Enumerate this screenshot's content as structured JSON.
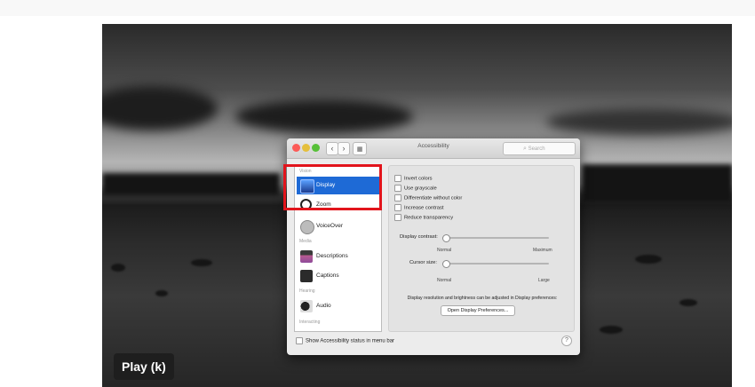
{
  "video": {
    "play_tooltip": "Play (k)"
  },
  "window": {
    "title": "Accessibility",
    "search_placeholder": "Search",
    "nav_back": "‹",
    "nav_forward": "›",
    "grid_icon": "grid-icon",
    "sidebar": {
      "sections": [
        "Vision",
        "Media",
        "Hearing",
        "Interacting"
      ],
      "items": [
        {
          "label": "Display",
          "icon": "display-icon",
          "selected": true
        },
        {
          "label": "Zoom",
          "icon": "zoom-icon",
          "selected": false
        },
        {
          "label": "VoiceOver",
          "icon": "voiceover-icon",
          "selected": false
        },
        {
          "label": "Descriptions",
          "icon": "descriptions-icon",
          "selected": false
        },
        {
          "label": "Captions",
          "icon": "captions-icon",
          "selected": false
        },
        {
          "label": "Audio",
          "icon": "audio-icon",
          "selected": false
        }
      ]
    },
    "options": [
      "Invert colors",
      "Use grayscale",
      "Differentiate without color",
      "Increase contrast",
      "Reduce transparency"
    ],
    "contrast": {
      "label": "Display contrast:",
      "min": "Normal",
      "max": "Maximum",
      "value": 0
    },
    "cursor": {
      "label": "Cursor size:",
      "min": "Normal",
      "max": "Large",
      "value": 0
    },
    "note": "Display resolution and brightness can be adjusted in Display preferences:",
    "open_button": "Open Display Preferences...",
    "status_checkbox": "Show Accessibility status in menu bar",
    "help": "?"
  },
  "colors": {
    "selection": "#1e6ad6",
    "highlight_box": "#e2141c"
  }
}
